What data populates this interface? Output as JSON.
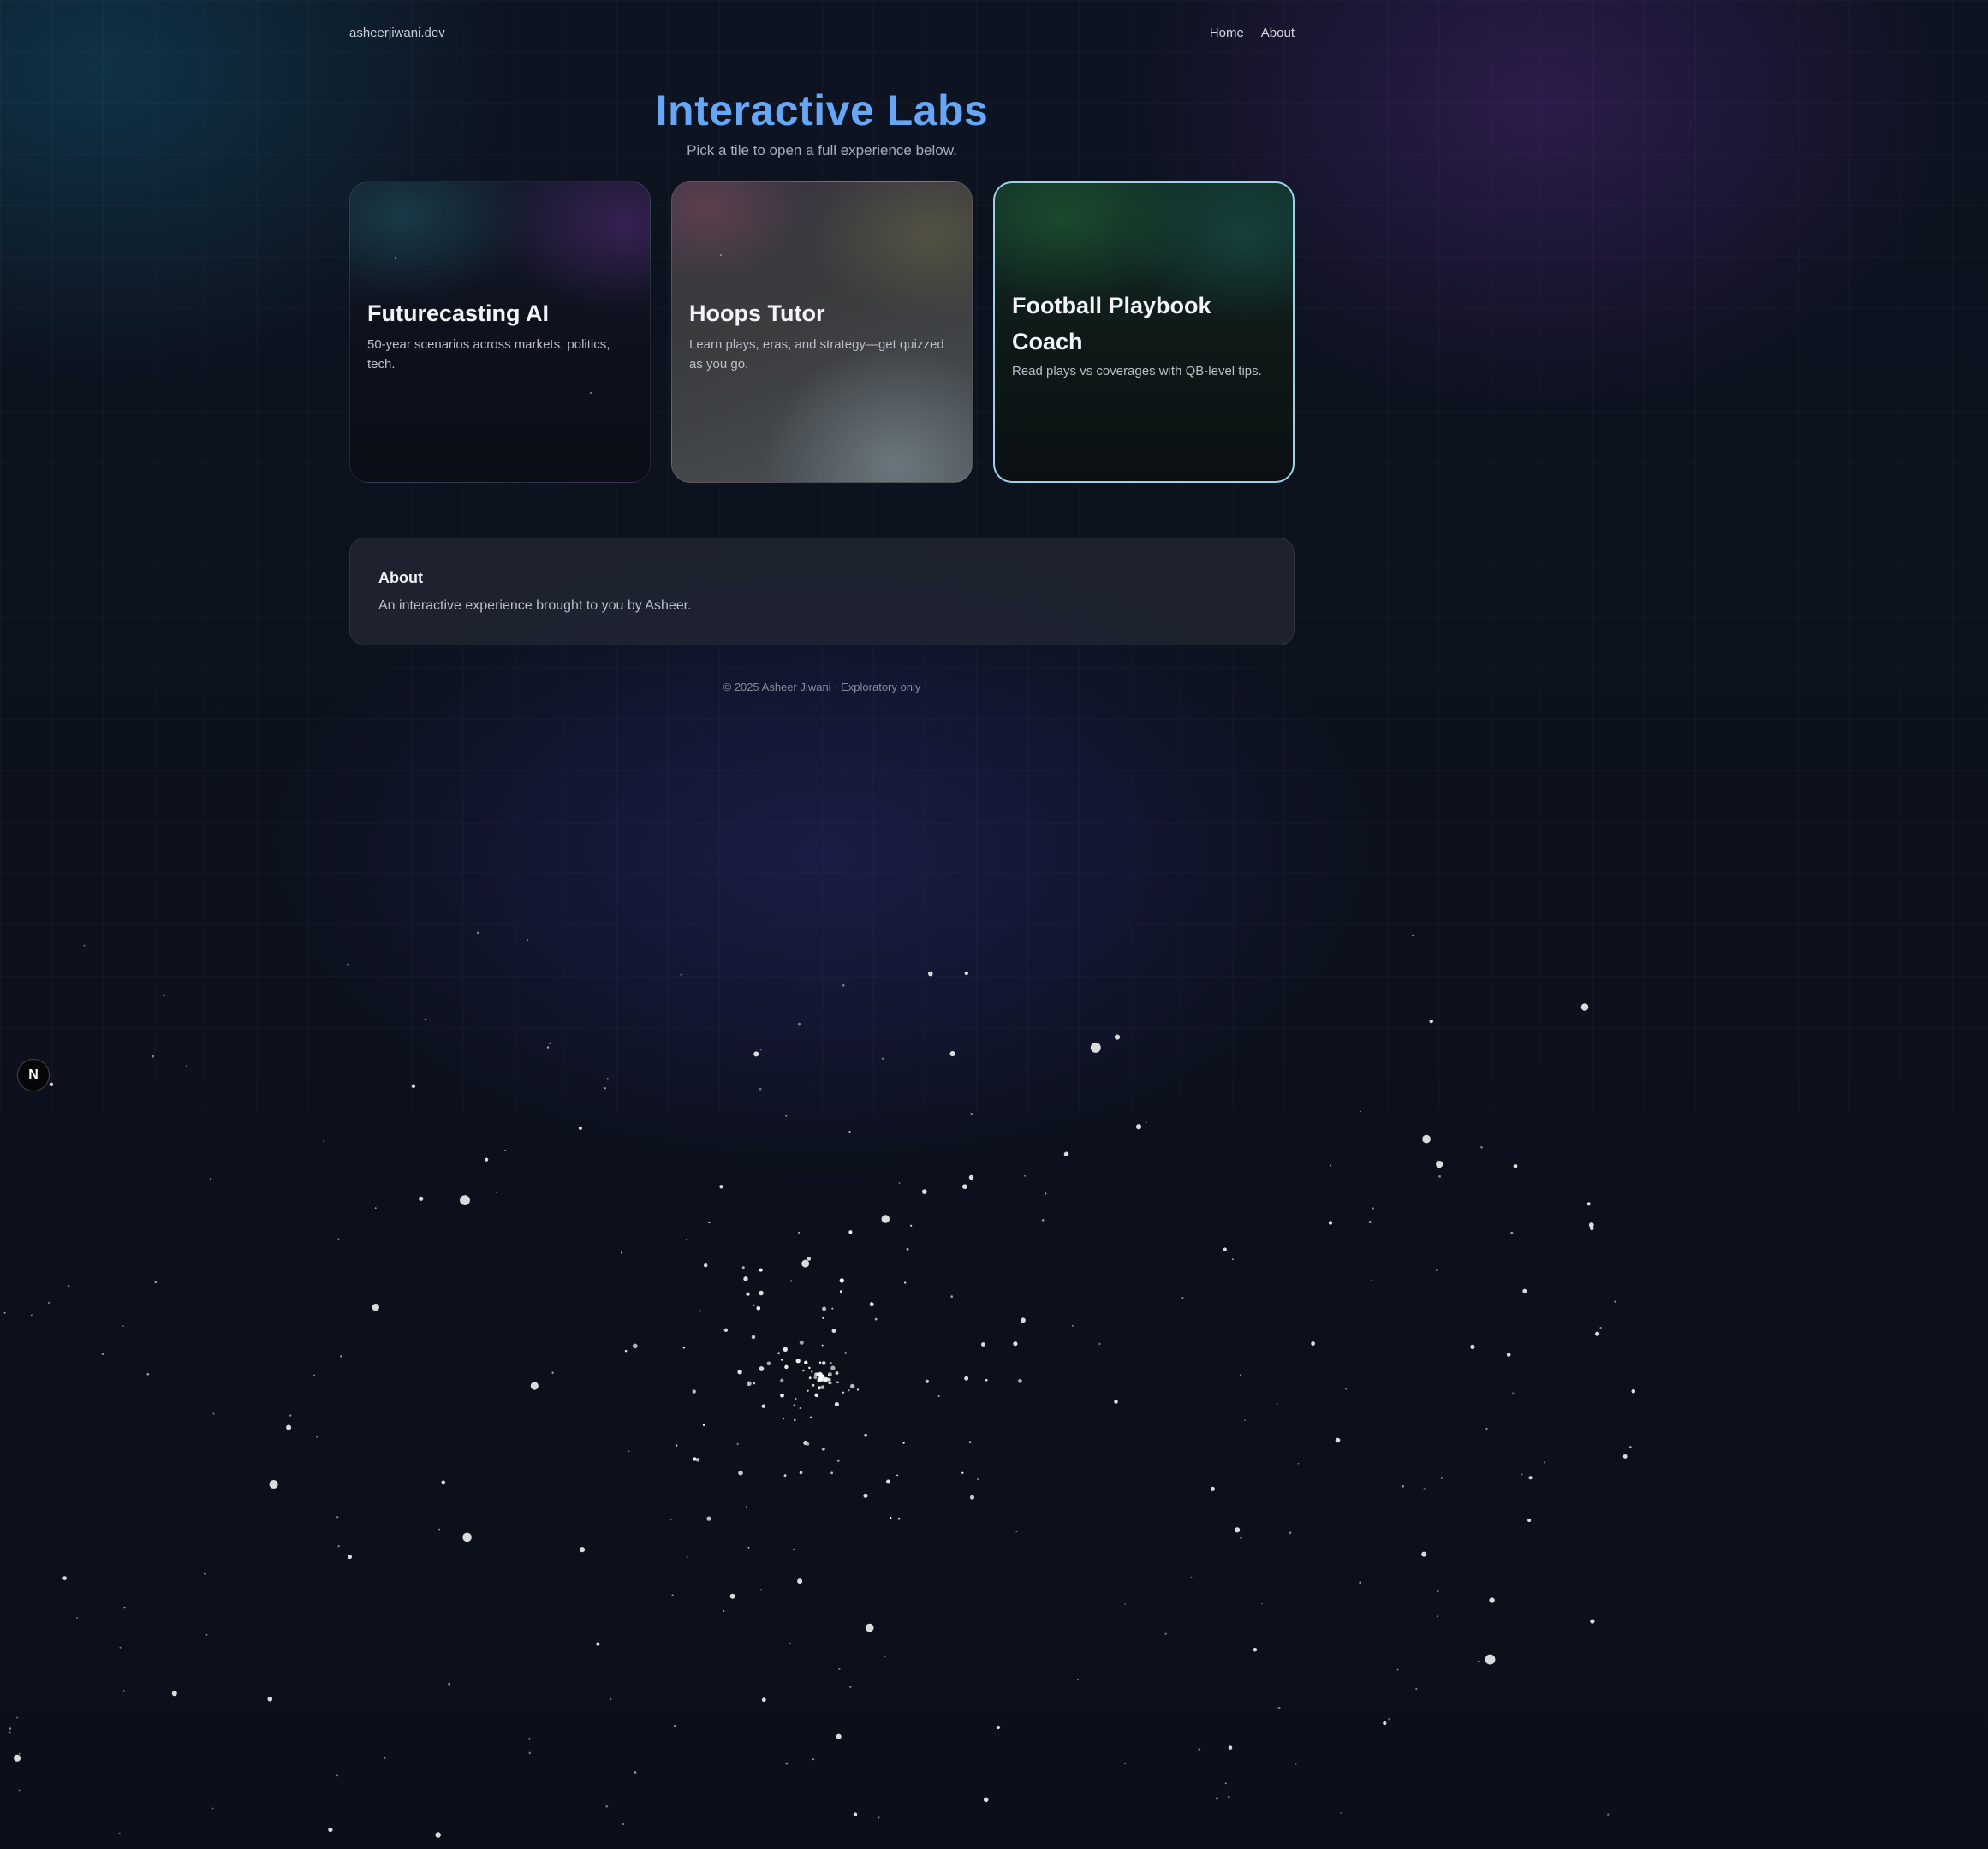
{
  "header": {
    "site_name": "asheerjiwani.dev",
    "nav": [
      {
        "label": "Home"
      },
      {
        "label": "About"
      }
    ]
  },
  "hero": {
    "title": "Interactive Labs",
    "subtitle": "Pick a tile to open a full experience below."
  },
  "tiles": [
    {
      "title": "Futurecasting AI",
      "description": "50-year scenarios across markets, politics, tech."
    },
    {
      "title": "Hoops Tutor",
      "description": "Learn plays, eras, and strategy—get quizzed as you go."
    },
    {
      "title": "Football Playbook Coach",
      "description": "Read plays vs coverages with QB-level tips."
    }
  ],
  "about": {
    "heading": "About",
    "text": "An interactive experience brought to you by Asheer."
  },
  "footer": {
    "text": "© 2025 Asheer Jiwani · Exploratory only"
  },
  "badge": {
    "label": "N"
  },
  "colors": {
    "title_accent": "#66a6f5",
    "selected_border": "#9fd0ea",
    "background": "#0b101a"
  }
}
